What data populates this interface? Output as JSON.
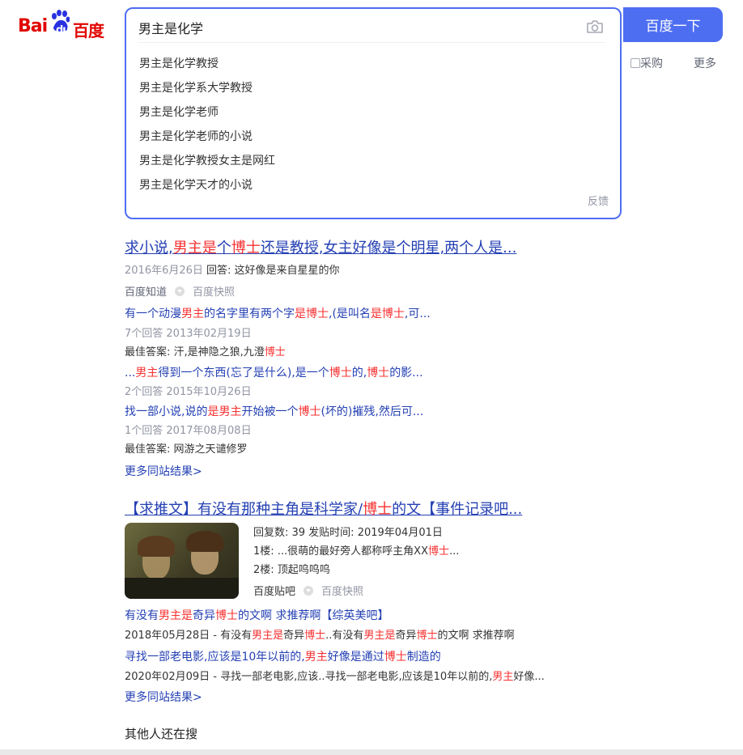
{
  "logo": {
    "text_bai": "Bai",
    "text_du": "du",
    "text_cn": "百度"
  },
  "search": {
    "query": "男主是化学",
    "button": "百度一下",
    "feedback": "反馈"
  },
  "suggestions": [
    "男主是化学教授",
    "男主是化学系大学教授",
    "男主是化学老师",
    "男主是化学老师的小说",
    "男主是化学教授女主是网红",
    "男主是化学天才的小说"
  ],
  "nav": {
    "buy": "采购",
    "more": "更多"
  },
  "r1": {
    "title_a": "求小说,",
    "title_b": "男主是",
    "title_c": "个",
    "title_d": "博士",
    "title_e": "还是教授,女主好像是个明星,两个人是...",
    "date": "2016年6月26日",
    "answer": "回答:  这好像是来自星星的你",
    "source": "百度知道",
    "snapshot": "百度快照",
    "q1_a": "有一个动漫",
    "q1_b": "男主",
    "q1_c": "的名字里有两个字",
    "q1_d": "是博士",
    "q1_e": ",(是叫名",
    "q1_f": "是博士",
    "q1_g": ",可...",
    "q1_meta": "7个回答  2013年02月19日",
    "q1_best_a": "最佳答案:  汗,是神隐之狼,九澄",
    "q1_best_b": "博士",
    "q2_a": "...",
    "q2_b": "男主",
    "q2_c": "得到一个东西(忘了是什么),是一个",
    "q2_d": "博士",
    "q2_e": "的,",
    "q2_f": "博士",
    "q2_g": "的影...",
    "q2_meta": "2个回答  2015年10月26日",
    "q3_a": "找一部小说,说的",
    "q3_b": "是男主",
    "q3_c": "开始被一个",
    "q3_d": "博士",
    "q3_e": "(坏的)摧残,然后可...",
    "q3_meta": "1个回答  2017年08月08日",
    "q3_best": "最佳答案:  网游之天谴修罗",
    "more": "更多同站结果>"
  },
  "r2": {
    "title_a": "【求推文】有没有那种主角是科学家/",
    "title_b": "博士",
    "title_c": "的文【事件记录吧...",
    "meta": "回复数: 39  发贴时间: 2019年04月01日",
    "floor1_a": "1楼: ...很萌的最好旁人都称呼主角XX",
    "floor1_b": "博士",
    "floor1_c": "...",
    "floor2": "2楼: 顶起呜呜呜",
    "source": "百度贴吧",
    "snapshot": "百度快照",
    "s1_a": "有没有",
    "s1_b": "男主是",
    "s1_c": "奇异",
    "s1_d": "博士",
    "s1_e": "的文啊 求推荐啊【综英美吧】",
    "s1_meta_a": "2018年05月28日 - 有没有",
    "s1_meta_b": "男主是",
    "s1_meta_c": "奇异",
    "s1_meta_d": "博士",
    "s1_meta_e": "..有没有",
    "s1_meta_f": "男主是",
    "s1_meta_g": "奇异",
    "s1_meta_h": "博士",
    "s1_meta_i": "的文啊 求推荐啊",
    "s2_a": "寻找一部老电影,应该是10年以前的,",
    "s2_b": "男主",
    "s2_c": "好像是通过",
    "s2_d": "博士",
    "s2_e": "制造的",
    "s2_meta_a": "2020年02月09日 - 寻找一部老电影,应该..寻找一部老电影,应该是10年以前的,",
    "s2_meta_b": "男主",
    "s2_meta_c": "好像...",
    "more": "更多同站结果>"
  },
  "others": {
    "title": "其他人还在搜"
  },
  "colors": {
    "accent": "#4e6ef2",
    "link": "#2440b3",
    "highlight": "#f73131"
  }
}
